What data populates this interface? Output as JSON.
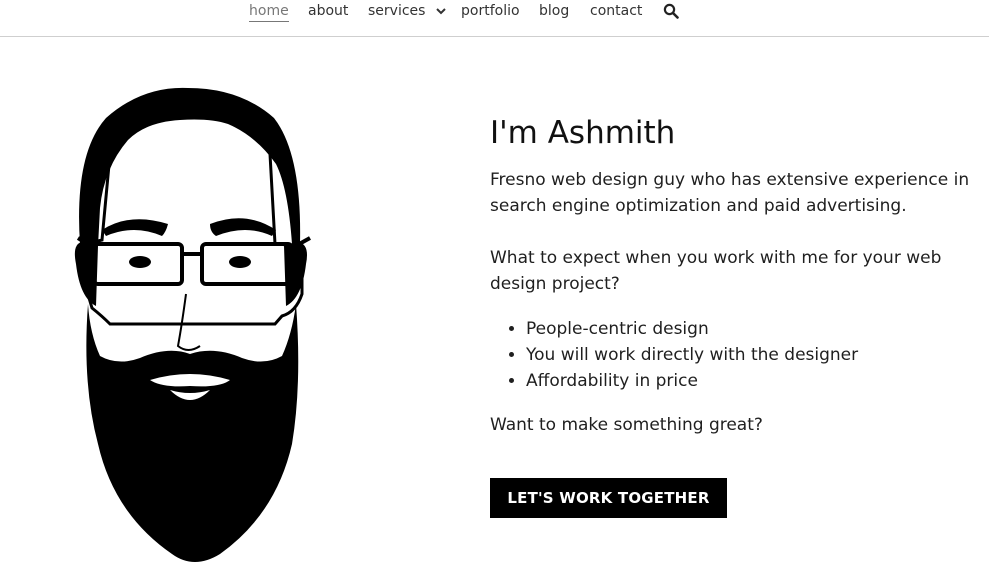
{
  "nav": {
    "items": [
      {
        "label": "home",
        "active": true
      },
      {
        "label": "about"
      },
      {
        "label": "services",
        "has_dropdown": true
      },
      {
        "label": "portfolio"
      },
      {
        "label": "blog"
      },
      {
        "label": "contact"
      }
    ],
    "search_icon": "search-icon",
    "dropdown_icon": "chevron-down-icon"
  },
  "hero": {
    "illustration": "bearded-man-illustration",
    "title": "I'm Ashmith",
    "intro": "Fresno web design guy who has extensive experience in search engine optimization and paid advertising.",
    "question": "What to expect when you work with me for your web design project?",
    "bullets": [
      "People-centric design",
      "You will work directly with the designer",
      "Affordability in price"
    ],
    "cta_prompt": "Want to make something great?",
    "cta_button": "LET'S WORK TOGETHER"
  },
  "colors": {
    "text": "#1f1f1f",
    "nav_text": "#333333",
    "nav_active": "#777777",
    "button_bg": "#000000",
    "button_text": "#ffffff",
    "divider": "#cfcfcf"
  }
}
